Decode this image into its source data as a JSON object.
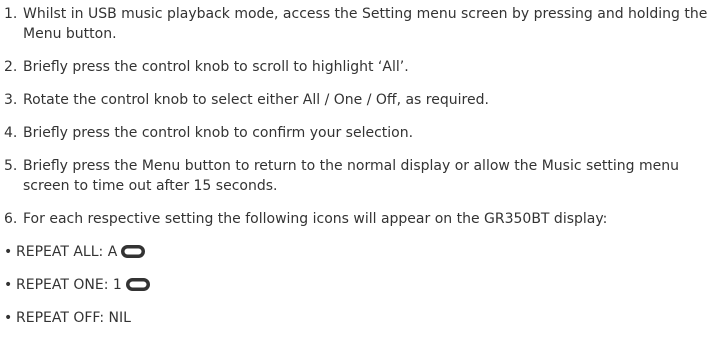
{
  "steps": [
    {
      "num": "1.",
      "text": "Whilst in USB music playback mode, access the Setting menu screen by pressing and holding the Menu button."
    },
    {
      "num": "2.",
      "text": "Briefly press the control knob to scroll to highlight ‘All’."
    },
    {
      "num": "3.",
      "text": "Rotate the control knob to select either All / One / Off, as required."
    },
    {
      "num": "4.",
      "text": "Briefly press the control knob to confirm your selection."
    },
    {
      "num": "5.",
      "text": "Briefly press the Menu button to return to the normal display or allow the Music setting menu screen to time out after 15 seconds."
    },
    {
      "num": "6.",
      "text": "For each respective setting the following icons will appear on the GR350BT display:"
    }
  ],
  "bullets": [
    {
      "marker": "•",
      "text": "REPEAT ALL: A",
      "icon": "repeat-icon"
    },
    {
      "marker": "•",
      "text": "REPEAT ONE: 1",
      "icon": "repeat-icon"
    },
    {
      "marker": "•",
      "text": "REPEAT OFF: NIL",
      "icon": ""
    }
  ]
}
